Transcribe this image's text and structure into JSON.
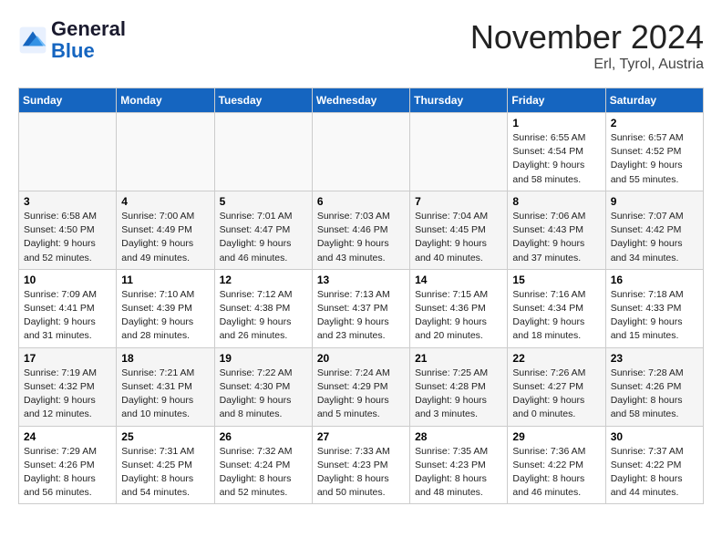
{
  "header": {
    "logo_general": "General",
    "logo_blue": "Blue",
    "month": "November 2024",
    "location": "Erl, Tyrol, Austria"
  },
  "weekdays": [
    "Sunday",
    "Monday",
    "Tuesday",
    "Wednesday",
    "Thursday",
    "Friday",
    "Saturday"
  ],
  "weeks": [
    [
      {
        "day": "",
        "info": ""
      },
      {
        "day": "",
        "info": ""
      },
      {
        "day": "",
        "info": ""
      },
      {
        "day": "",
        "info": ""
      },
      {
        "day": "",
        "info": ""
      },
      {
        "day": "1",
        "info": "Sunrise: 6:55 AM\nSunset: 4:54 PM\nDaylight: 9 hours and 58 minutes."
      },
      {
        "day": "2",
        "info": "Sunrise: 6:57 AM\nSunset: 4:52 PM\nDaylight: 9 hours and 55 minutes."
      }
    ],
    [
      {
        "day": "3",
        "info": "Sunrise: 6:58 AM\nSunset: 4:50 PM\nDaylight: 9 hours and 52 minutes."
      },
      {
        "day": "4",
        "info": "Sunrise: 7:00 AM\nSunset: 4:49 PM\nDaylight: 9 hours and 49 minutes."
      },
      {
        "day": "5",
        "info": "Sunrise: 7:01 AM\nSunset: 4:47 PM\nDaylight: 9 hours and 46 minutes."
      },
      {
        "day": "6",
        "info": "Sunrise: 7:03 AM\nSunset: 4:46 PM\nDaylight: 9 hours and 43 minutes."
      },
      {
        "day": "7",
        "info": "Sunrise: 7:04 AM\nSunset: 4:45 PM\nDaylight: 9 hours and 40 minutes."
      },
      {
        "day": "8",
        "info": "Sunrise: 7:06 AM\nSunset: 4:43 PM\nDaylight: 9 hours and 37 minutes."
      },
      {
        "day": "9",
        "info": "Sunrise: 7:07 AM\nSunset: 4:42 PM\nDaylight: 9 hours and 34 minutes."
      }
    ],
    [
      {
        "day": "10",
        "info": "Sunrise: 7:09 AM\nSunset: 4:41 PM\nDaylight: 9 hours and 31 minutes."
      },
      {
        "day": "11",
        "info": "Sunrise: 7:10 AM\nSunset: 4:39 PM\nDaylight: 9 hours and 28 minutes."
      },
      {
        "day": "12",
        "info": "Sunrise: 7:12 AM\nSunset: 4:38 PM\nDaylight: 9 hours and 26 minutes."
      },
      {
        "day": "13",
        "info": "Sunrise: 7:13 AM\nSunset: 4:37 PM\nDaylight: 9 hours and 23 minutes."
      },
      {
        "day": "14",
        "info": "Sunrise: 7:15 AM\nSunset: 4:36 PM\nDaylight: 9 hours and 20 minutes."
      },
      {
        "day": "15",
        "info": "Sunrise: 7:16 AM\nSunset: 4:34 PM\nDaylight: 9 hours and 18 minutes."
      },
      {
        "day": "16",
        "info": "Sunrise: 7:18 AM\nSunset: 4:33 PM\nDaylight: 9 hours and 15 minutes."
      }
    ],
    [
      {
        "day": "17",
        "info": "Sunrise: 7:19 AM\nSunset: 4:32 PM\nDaylight: 9 hours and 12 minutes."
      },
      {
        "day": "18",
        "info": "Sunrise: 7:21 AM\nSunset: 4:31 PM\nDaylight: 9 hours and 10 minutes."
      },
      {
        "day": "19",
        "info": "Sunrise: 7:22 AM\nSunset: 4:30 PM\nDaylight: 9 hours and 8 minutes."
      },
      {
        "day": "20",
        "info": "Sunrise: 7:24 AM\nSunset: 4:29 PM\nDaylight: 9 hours and 5 minutes."
      },
      {
        "day": "21",
        "info": "Sunrise: 7:25 AM\nSunset: 4:28 PM\nDaylight: 9 hours and 3 minutes."
      },
      {
        "day": "22",
        "info": "Sunrise: 7:26 AM\nSunset: 4:27 PM\nDaylight: 9 hours and 0 minutes."
      },
      {
        "day": "23",
        "info": "Sunrise: 7:28 AM\nSunset: 4:26 PM\nDaylight: 8 hours and 58 minutes."
      }
    ],
    [
      {
        "day": "24",
        "info": "Sunrise: 7:29 AM\nSunset: 4:26 PM\nDaylight: 8 hours and 56 minutes."
      },
      {
        "day": "25",
        "info": "Sunrise: 7:31 AM\nSunset: 4:25 PM\nDaylight: 8 hours and 54 minutes."
      },
      {
        "day": "26",
        "info": "Sunrise: 7:32 AM\nSunset: 4:24 PM\nDaylight: 8 hours and 52 minutes."
      },
      {
        "day": "27",
        "info": "Sunrise: 7:33 AM\nSunset: 4:23 PM\nDaylight: 8 hours and 50 minutes."
      },
      {
        "day": "28",
        "info": "Sunrise: 7:35 AM\nSunset: 4:23 PM\nDaylight: 8 hours and 48 minutes."
      },
      {
        "day": "29",
        "info": "Sunrise: 7:36 AM\nSunset: 4:22 PM\nDaylight: 8 hours and 46 minutes."
      },
      {
        "day": "30",
        "info": "Sunrise: 7:37 AM\nSunset: 4:22 PM\nDaylight: 8 hours and 44 minutes."
      }
    ]
  ]
}
